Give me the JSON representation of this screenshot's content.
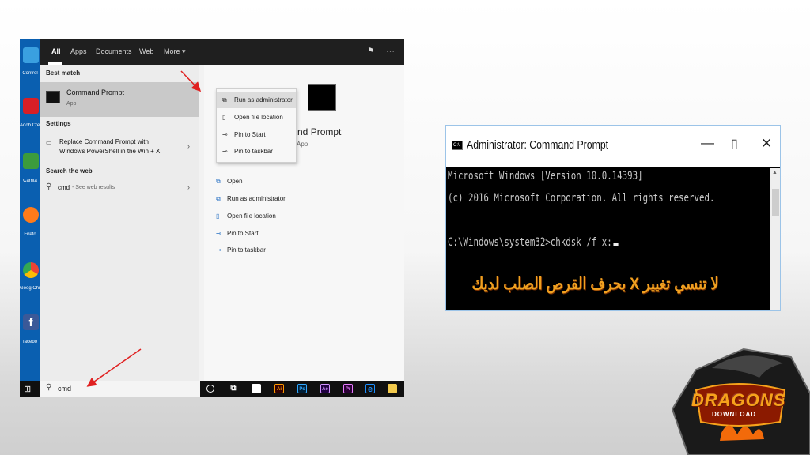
{
  "left_screenshot": {
    "desktop_icons": [
      {
        "label": "Control",
        "color": "#3aa0e0"
      },
      {
        "label": "Adob Creat",
        "color": "#d81f26"
      },
      {
        "label": "Camta",
        "color": "#3c9b3c"
      },
      {
        "label": "Firefo",
        "color": "#ff7b1a"
      },
      {
        "label": "Goog Chron",
        "color": "#34a853"
      },
      {
        "label": "facebo",
        "color": "#3b5998"
      }
    ],
    "tabs": [
      "All",
      "Apps",
      "Documents",
      "Web",
      "More ▾"
    ],
    "left_pane": {
      "best_match_heading": "Best match",
      "best_match": {
        "title": "Command Prompt",
        "subtitle": "App"
      },
      "settings_heading": "Settings",
      "settings_line1": "Replace Command Prompt with",
      "settings_line2": "Windows PowerShell in the Win + X",
      "web_heading": "Search the web",
      "web_query": "cmd",
      "web_hint": "- See web results"
    },
    "context_menu": [
      "Run as administrator",
      "Open file location",
      "Pin to Start",
      "Pin to taskbar"
    ],
    "preview": {
      "title": "Command Prompt",
      "subtitle": "App"
    },
    "actions": [
      "Open",
      "Run as administrator",
      "Open file location",
      "Pin to Start",
      "Pin to taskbar"
    ],
    "taskbar": {
      "search_value": "cmd",
      "apps": [
        {
          "label": "Ai",
          "color": "#ff9a00",
          "bg": "#330000"
        },
        {
          "label": "Ps",
          "color": "#31a8ff",
          "bg": "#001e36"
        },
        {
          "label": "Ae",
          "color": "#d291ff",
          "bg": "#1f0040"
        },
        {
          "label": "Pr",
          "color": "#e77bff",
          "bg": "#2a0034"
        },
        {
          "label": "e",
          "color": "#1e90ff",
          "bg": "#101010"
        },
        {
          "label": "",
          "color": "#f2c94c",
          "bg": "#f2c94c"
        }
      ]
    }
  },
  "cmd_window": {
    "title": "Administrator: Command Prompt",
    "icon_text": "C:\\",
    "lines": [
      "Microsoft Windows [Version 10.0.14393]",
      "(c) 2016 Microsoft Corporation. All rights reserved.",
      "",
      "C:\\Windows\\system32>chkdsk /f x:"
    ],
    "overlay_note": "لا تنسي تغيير X بحرف القرص الصلب لديك"
  },
  "logo": {
    "text": "DRAGONS",
    "sub": "DOWNLOAD"
  },
  "colors": {
    "accent_blue": "#0a5fb0",
    "arrow_red": "#e02020",
    "overlay_orange": "#f0a020"
  }
}
